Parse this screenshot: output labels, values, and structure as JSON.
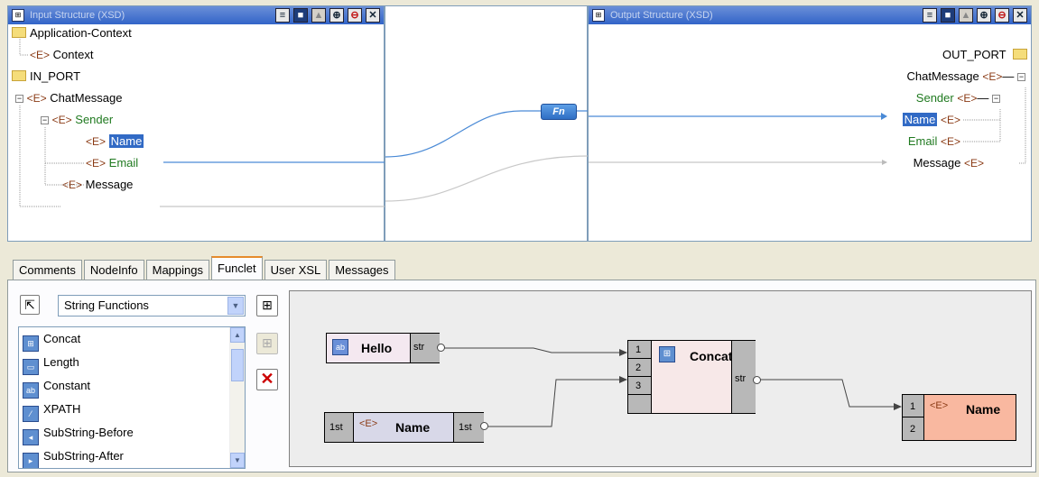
{
  "left_pane": {
    "title": "Input Structure (XSD)",
    "nodes": [
      {
        "tag": "",
        "label": "Application-Context"
      },
      {
        "tag": "<E>",
        "label": "Context"
      },
      {
        "tag": "",
        "label": "IN_PORT"
      },
      {
        "tag": "<E>",
        "label": "ChatMessage"
      },
      {
        "tag": "<E>",
        "label": "Sender"
      },
      {
        "tag": "<E>",
        "label": "Name"
      },
      {
        "tag": "<E>",
        "label": "Email"
      },
      {
        "tag": "<E>",
        "label": "Message"
      }
    ]
  },
  "middle": {
    "fn_label": "Fn"
  },
  "right_pane": {
    "title": "Output Structure (XSD)",
    "nodes": [
      {
        "tag": "",
        "label": "OUT_PORT"
      },
      {
        "tag": "<E>",
        "label": "ChatMessage"
      },
      {
        "tag": "<E>",
        "label": "Sender"
      },
      {
        "tag": "<E>",
        "label": "Name"
      },
      {
        "tag": "<E>",
        "label": "Email"
      },
      {
        "tag": "<E>",
        "label": "Message"
      }
    ]
  },
  "tabs": [
    "Comments",
    "NodeInfo",
    "Mappings",
    "Funclet",
    "User XSL",
    "Messages"
  ],
  "active_tab": "Funclet",
  "function_category": "String Functions",
  "functions": [
    {
      "icon": "concat-icon",
      "label": "Concat"
    },
    {
      "icon": "length-icon",
      "label": "Length"
    },
    {
      "icon": "constant-icon",
      "label": "Constant"
    },
    {
      "icon": "xpath-icon",
      "label": "XPATH"
    },
    {
      "icon": "substring-before-icon",
      "label": "SubString-Before"
    },
    {
      "icon": "substring-after-icon",
      "label": "SubString-After"
    }
  ],
  "funclet": {
    "hello": {
      "label": "Hello",
      "port": "str"
    },
    "name_in": {
      "prefix": "1st",
      "tag": "<E>",
      "label": "Name",
      "port": "1st"
    },
    "concat": {
      "label": "Concat",
      "inputs": [
        "1",
        "2",
        "3"
      ],
      "output": "str"
    },
    "name_out": {
      "tag": "<E>",
      "label": "Name",
      "inputs": [
        "1",
        "2"
      ]
    }
  },
  "colors": {
    "titlebar": "#3264c8",
    "selection": "#316ac5",
    "link": "#4a8ad6",
    "concat_fill": "#f7e8e8",
    "name_out_fill": "#f9b8a0",
    "green_label": "#207a20"
  }
}
